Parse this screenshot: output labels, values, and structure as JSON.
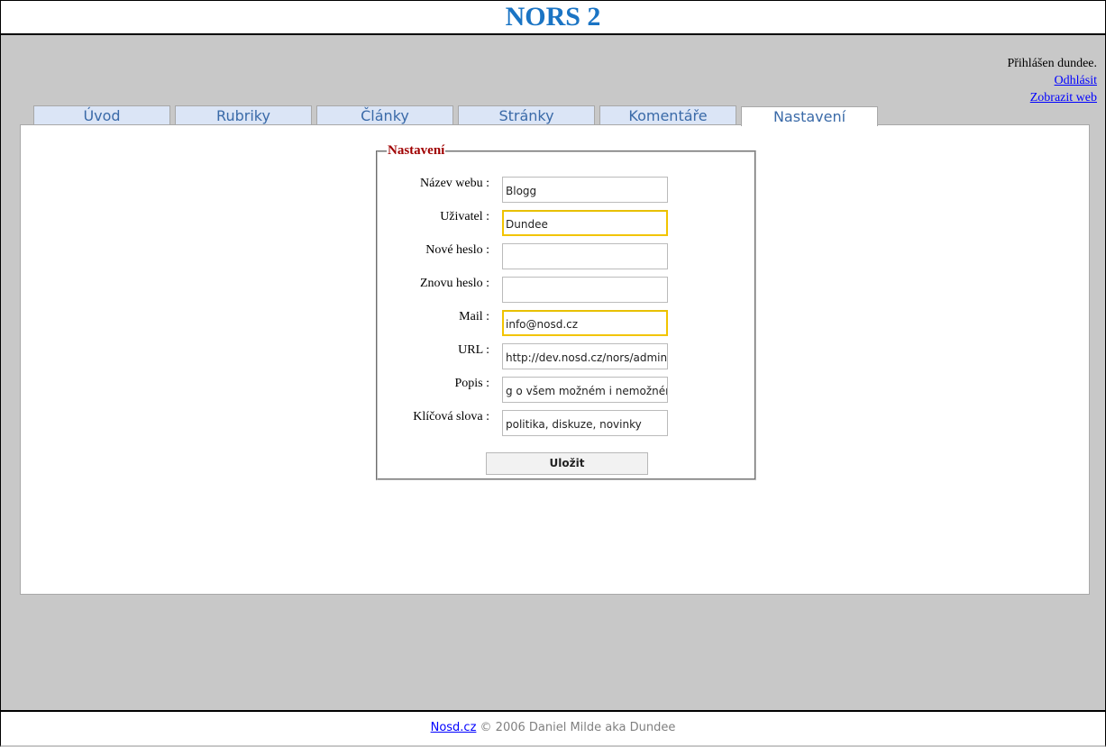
{
  "header": {
    "title": "NORS 2"
  },
  "user": {
    "status": "Přihlášen dundee.",
    "logout": "Odhlásit",
    "view_site": "Zobrazit web"
  },
  "tabs": [
    {
      "label": "Úvod"
    },
    {
      "label": "Rubriky"
    },
    {
      "label": "Články"
    },
    {
      "label": "Stránky"
    },
    {
      "label": "Komentáře"
    },
    {
      "label": "Nastavení",
      "active": true
    }
  ],
  "form": {
    "legend": "Nastavení",
    "fields": [
      {
        "label": "Název webu :",
        "value": "Blogg"
      },
      {
        "label": "Uživatel :",
        "value": "Dundee"
      },
      {
        "label": "Nové heslo :",
        "value": ""
      },
      {
        "label": "Znovu heslo :",
        "value": ""
      },
      {
        "label": "Mail :",
        "value": "info@nosd.cz"
      },
      {
        "label": "URL :",
        "value": "http://dev.nosd.cz/nors/admin"
      },
      {
        "label": "Popis :",
        "value": "g o všem možném i nemožném"
      },
      {
        "label": "Klíčová slova :",
        "value": "politika, diskuze, novinky"
      }
    ],
    "save_label": "Uložit"
  },
  "footer": {
    "link": "Nosd.cz",
    "text": " © 2006 Daniel Milde aka Dundee"
  }
}
